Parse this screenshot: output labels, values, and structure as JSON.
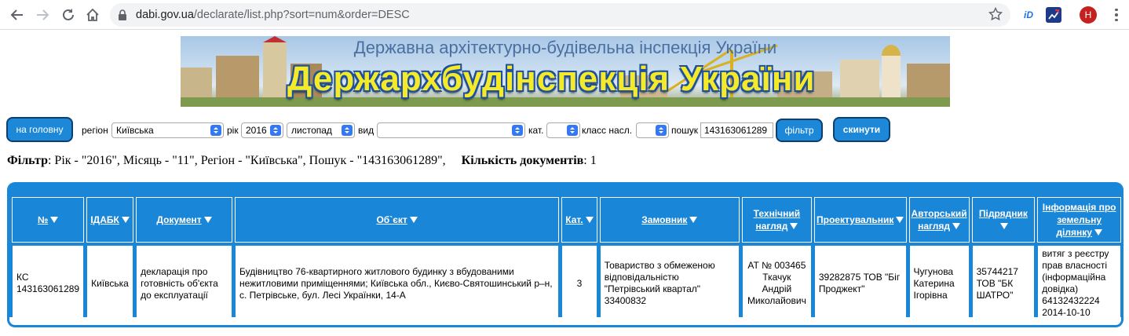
{
  "browser": {
    "url_domain": "dabi.gov.ua",
    "url_path": "/declarate/list.php?sort=num&order=DESC",
    "ext1_label": "iD",
    "avatar_letter": "Н"
  },
  "banner": {
    "subtitle": "Державна архітектурно-будівельна інспекція України",
    "title": "Держархбудінспекція України"
  },
  "filter_bar": {
    "home_button": "на головну",
    "region_label": "регіон",
    "region_value": "Київська",
    "year_label": "рік",
    "year_value": "2016",
    "month_value": "листопад",
    "type_label": "вид",
    "type_value": "",
    "cat_label": "кат.",
    "cat_value": "",
    "class_label": "класс насл.",
    "class_value": "",
    "search_label": "пошук",
    "search_value": "143163061289",
    "filter_button": "фільтр",
    "reset_button": "скинути"
  },
  "summary": {
    "filter_label": "Фільтр",
    "filter_text": ": Рік - \"2016\", Місяць - \"11\", Регіон - \"Київська\", Пошук - \"143163061289\",",
    "count_label": "Кількість документів",
    "count_value": ": 1"
  },
  "table": {
    "headers": [
      "№",
      "ІДАБК",
      "Документ",
      "Об`єкт",
      "Кат.",
      "Замовник",
      "Технічний нагляд",
      "Проектувальник",
      "Авторський нагляд",
      "Підрядник",
      "Інформація про земельну ділянку"
    ],
    "rows": [
      [
        "КС 143163061289",
        "Київська",
        "декларація про готовність об'єкта до експлуатації",
        "Будівництво 76-квартирного житлового будинку з вбудованими нежитловими приміщеннями; Київська обл., Києво-Святошинський р–н, с. Петрівське, бул. Лесі Українки, 14-А",
        "3",
        "Товариство з обмеженою відповідальністю \"Петрівський квартал\" 33400832",
        "АТ № 003465 Ткачук Андрій Миколайович",
        "39282875 ТОВ \"Біг Проджект\"",
        "Чугунова Катерина Ігорівна",
        "35744217 ТОВ \"БК ШАТРО\"",
        "витяг з реєстру прав власності (інформаційна довідка) 64132432224 2014-10-10"
      ]
    ]
  },
  "colors": {
    "table_blue": "#1a86d8",
    "button_blue": "#1e88d8",
    "banner_yellow": "#f4ea2a"
  }
}
